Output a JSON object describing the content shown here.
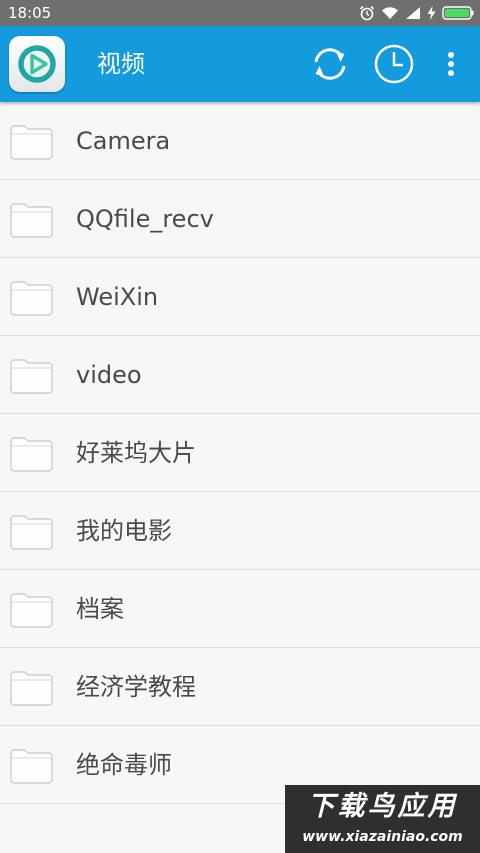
{
  "status_bar": {
    "time": "18:05",
    "icons": [
      "alarm-icon",
      "wifi-icon",
      "signal-icon",
      "charging-icon",
      "battery-icon"
    ],
    "battery_color": "#4cd964"
  },
  "app_bar": {
    "title": "视频",
    "background_color": "#139bdd",
    "logo_icon": "play-icon",
    "actions": [
      "sync-icon",
      "history-clock-icon",
      "more-vert-icon"
    ]
  },
  "folders": [
    {
      "name": "Camera"
    },
    {
      "name": "QQfile_recv"
    },
    {
      "name": "WeiXin"
    },
    {
      "name": "video"
    },
    {
      "name": "好莱坞大片"
    },
    {
      "name": "我的电影"
    },
    {
      "name": "档案"
    },
    {
      "name": "经济学教程"
    },
    {
      "name": "绝命毒师"
    }
  ],
  "watermark": {
    "title": "下载鸟应用",
    "url": "www.xiazainiao.com"
  }
}
